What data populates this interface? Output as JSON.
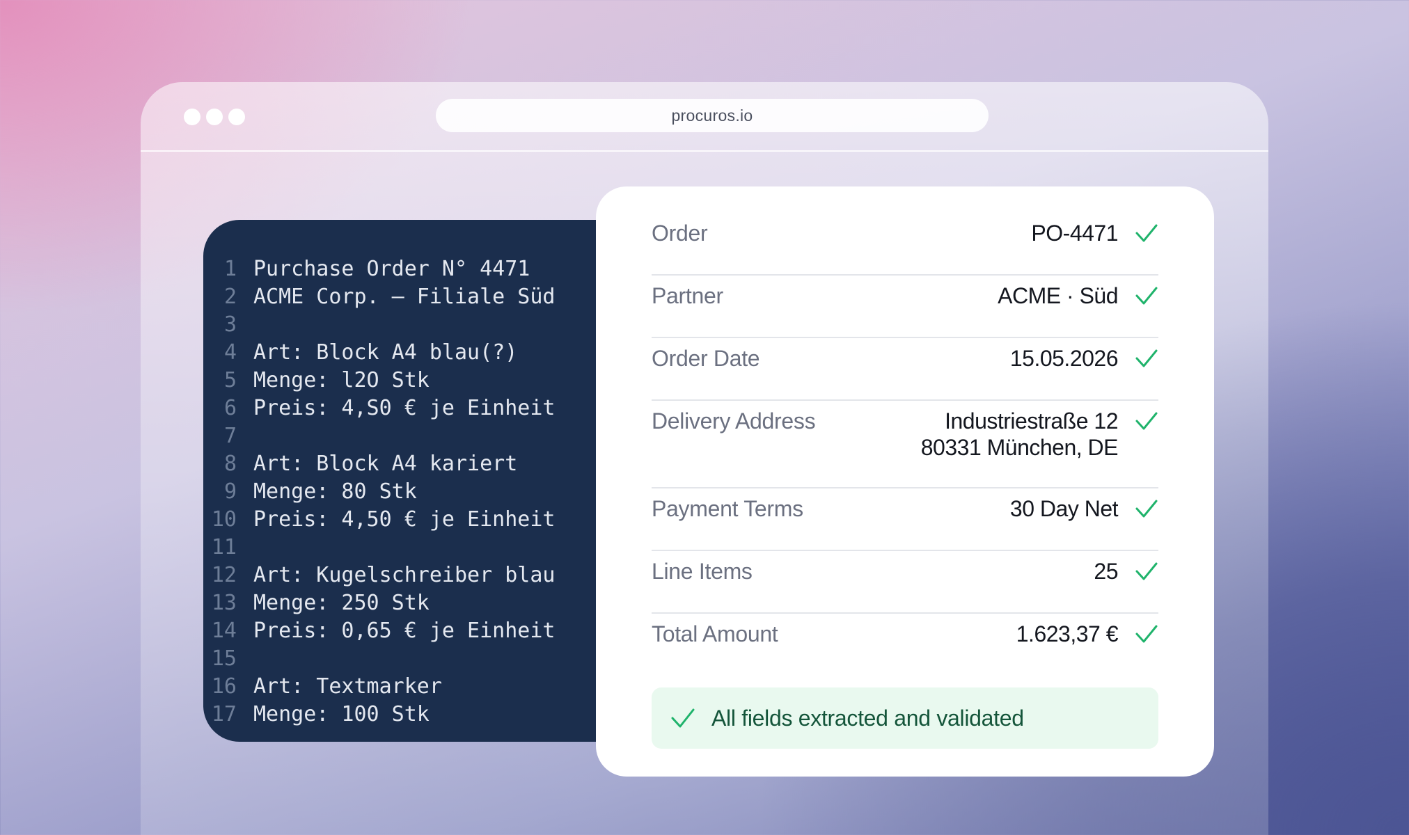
{
  "browser": {
    "url": "procuros.io"
  },
  "code": {
    "lines": [
      {
        "n": "1",
        "text": "Purchase Order N° 4471"
      },
      {
        "n": "2",
        "text": "ACME Corp. — Filiale Süd"
      },
      {
        "n": "3",
        "text": ""
      },
      {
        "n": "4",
        "text": "Art: Block A4 blau(?)"
      },
      {
        "n": "5",
        "text": "Menge: l2O Stk"
      },
      {
        "n": "6",
        "text": "Preis: 4,S0 € je Einheit"
      },
      {
        "n": "7",
        "text": ""
      },
      {
        "n": "8",
        "text": "Art: Block A4 kariert"
      },
      {
        "n": "9",
        "text": "Menge: 80 Stk"
      },
      {
        "n": "10",
        "text": "Preis: 4,50 € je Einheit"
      },
      {
        "n": "11",
        "text": ""
      },
      {
        "n": "12",
        "text": "Art: Kugelschreiber blau"
      },
      {
        "n": "13",
        "text": "Menge: 250 Stk"
      },
      {
        "n": "14",
        "text": "Preis: 0,65 € je Einheit"
      },
      {
        "n": "15",
        "text": ""
      },
      {
        "n": "16",
        "text": "Art: Textmarker"
      },
      {
        "n": "17",
        "text": "Menge: 100 Stk"
      }
    ]
  },
  "fields": {
    "order": {
      "label": "Order",
      "value": "PO-4471"
    },
    "partner": {
      "label": "Partner",
      "value": "ACME · Süd"
    },
    "order_date": {
      "label": "Order Date",
      "value": "15.05.2026"
    },
    "delivery_address": {
      "label": "Delivery Address",
      "line1": "Industriestraße 12",
      "line2": "80331 München, DE"
    },
    "payment_terms": {
      "label": "Payment Terms",
      "value": "30 Day Net"
    },
    "line_items": {
      "label": "Line Items",
      "value": "25"
    },
    "total_amount": {
      "label": "Total Amount",
      "value": "1.623,37 €"
    }
  },
  "banner": {
    "text": "All fields extracted and validated"
  },
  "colors": {
    "check_green": "#1fb36b",
    "code_bg": "#1b2e4d",
    "banner_bg": "#e9f9ef"
  },
  "icons": {
    "check": "check-icon",
    "window_dot": "window-dot-icon"
  }
}
